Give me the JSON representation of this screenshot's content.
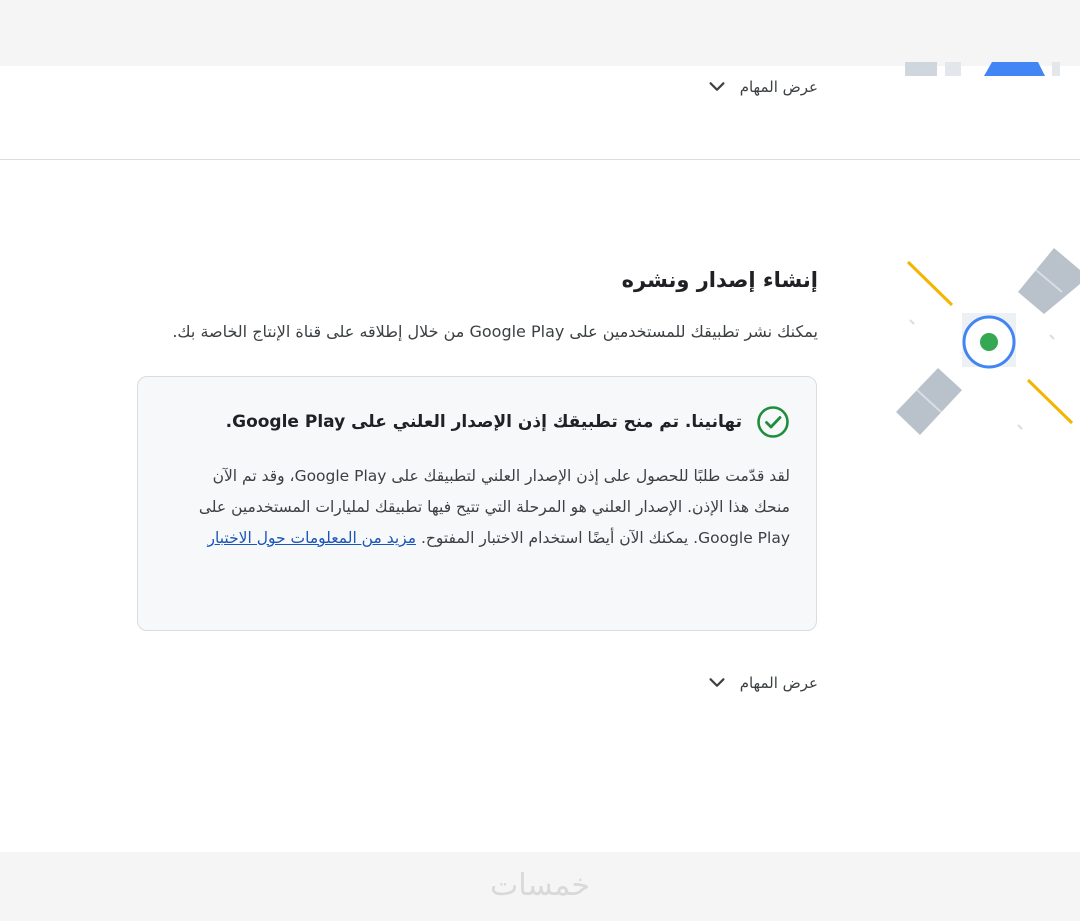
{
  "tasks_toggle_label": "عرض المهام",
  "release": {
    "title": "إنشاء إصدار ونشره",
    "description": "يمكنك نشر تطبيقك للمستخدمين على Google Play من خلال إطلاقه على قناة الإنتاج الخاصة بك."
  },
  "notice": {
    "title": "تهانينا. تم منح تطبيقك إذن الإصدار العلني على Google Play.",
    "body": "لقد قدّمت طلبًا للحصول على إذن الإصدار العلني لتطبيقك على Google Play، وقد تم الآن منحك هذا الإذن. الإصدار العلني هو المرحلة التي تتيح فيها تطبيقك لمليارات المستخدمين على Google Play. يمكنك الآن أيضًا استخدام الاختبار المفتوح. ",
    "link_text": "مزيد من المعلومات حول الاختبار"
  },
  "watermark": "خمسات",
  "colors": {
    "success": "#1e8e3e",
    "link": "#1a56b8",
    "satellite_blue": "#4285f4",
    "satellite_green": "#34a853",
    "satellite_yellow": "#f4b400"
  }
}
